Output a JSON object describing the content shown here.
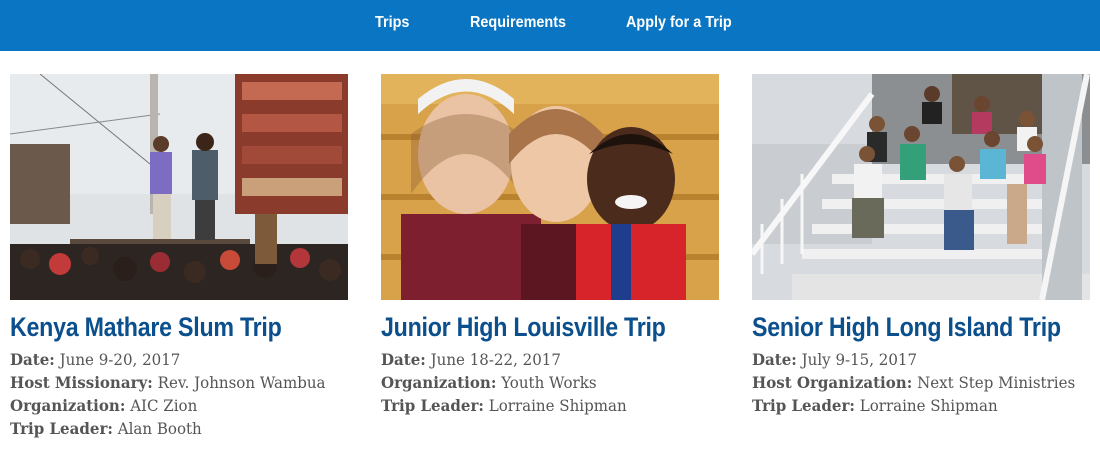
{
  "nav": {
    "items": [
      "Trips",
      "Requirements",
      "Apply for a Trip"
    ]
  },
  "colors": {
    "nav_bg": "#0a75c2",
    "title": "#0b4f8c",
    "text": "#555555"
  },
  "trips": [
    {
      "title": "Kenya Mathare Slum Trip",
      "details": [
        {
          "label": "Date:",
          "value": "June 9-20, 2017"
        },
        {
          "label": "Host Missionary:",
          "value": "Rev. Johnson Wambua"
        },
        {
          "label": "Organization:",
          "value": "AIC Zion"
        },
        {
          "label": "Trip Leader:",
          "value": "Alan Booth"
        }
      ]
    },
    {
      "title": "Junior High Louisville Trip",
      "details": [
        {
          "label": "Date:",
          "value": "June 18-22, 2017"
        },
        {
          "label": "Organization:",
          "value": "Youth Works"
        },
        {
          "label": "Trip Leader:",
          "value": "Lorraine Shipman"
        }
      ]
    },
    {
      "title": "Senior High Long Island Trip",
      "details": [
        {
          "label": "Date:",
          "value": "July 9-15, 2017"
        },
        {
          "label": "Host Organization:",
          "value": "Next Step Ministries"
        },
        {
          "label": "Trip Leader:",
          "value": "Lorraine Shipman"
        }
      ]
    }
  ]
}
